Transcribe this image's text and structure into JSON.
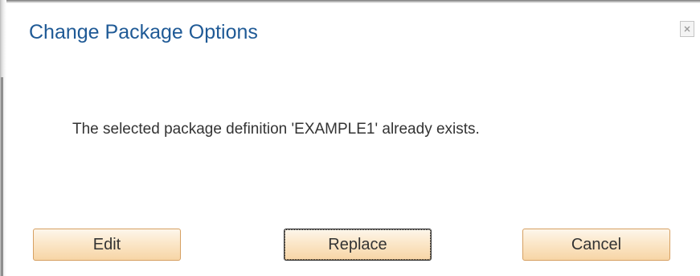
{
  "dialog": {
    "title": "Change Package Options",
    "close_icon": "close-icon",
    "message": "The selected package definition 'EXAMPLE1' already exists."
  },
  "buttons": {
    "edit_label": "Edit",
    "replace_label": "Replace",
    "cancel_label": "Cancel",
    "focused": "Replace"
  },
  "colors": {
    "title": "#1f5a96",
    "button_fill": "#fbe7c9",
    "button_border": "#d6a062",
    "text": "#333333"
  }
}
